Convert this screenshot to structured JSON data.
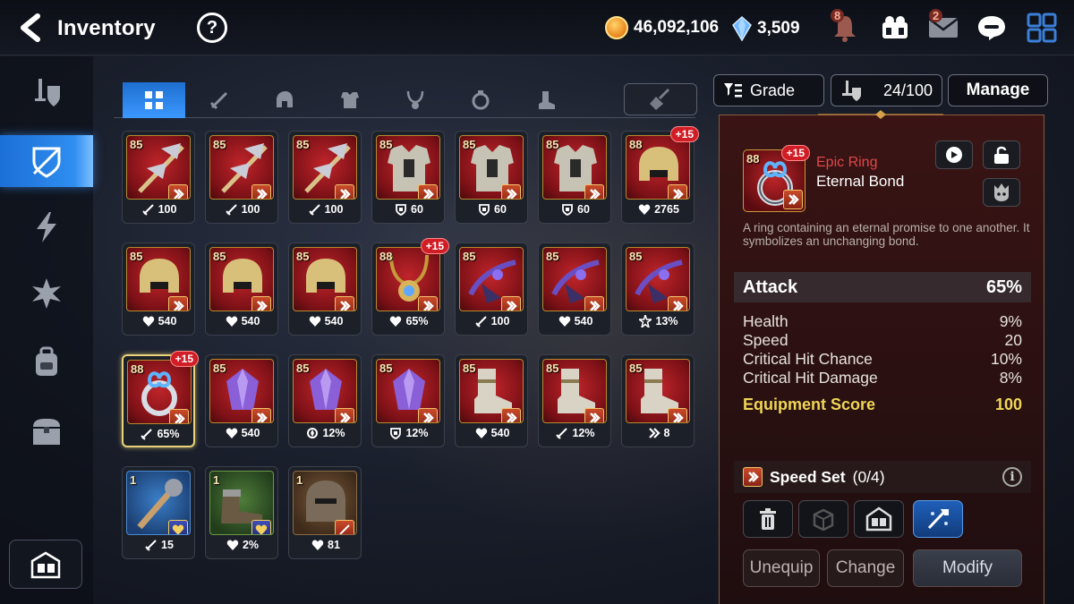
{
  "header": {
    "title": "Inventory",
    "help_label": "?",
    "gold": "46,092,106",
    "crystals": "3,509",
    "notifications_count": "8",
    "mail_count": "2"
  },
  "sidebar": {
    "items": [
      {
        "name": "equipment-tab"
      },
      {
        "name": "gear-tab",
        "active": true
      },
      {
        "name": "artifact-tab"
      },
      {
        "name": "catalyst-tab"
      },
      {
        "name": "materials-tab"
      },
      {
        "name": "chest-tab"
      }
    ]
  },
  "tabs": [
    "all",
    "weapon",
    "helmet",
    "armor",
    "necklace",
    "ring",
    "boots"
  ],
  "controls": {
    "sort_label": "Grade",
    "capacity": "24/100",
    "manage_label": "Manage"
  },
  "items": [
    {
      "level": "85",
      "stat": "100",
      "stat_icon": "attack"
    },
    {
      "level": "85",
      "stat": "100",
      "stat_icon": "attack"
    },
    {
      "level": "85",
      "stat": "100",
      "stat_icon": "attack"
    },
    {
      "level": "85",
      "stat": "60",
      "stat_icon": "defense"
    },
    {
      "level": "85",
      "stat": "60",
      "stat_icon": "defense"
    },
    {
      "level": "85",
      "stat": "60",
      "stat_icon": "defense"
    },
    {
      "level": "88",
      "stat": "2765",
      "stat_icon": "health",
      "enhance": "+15"
    },
    {
      "level": "85",
      "stat": "540",
      "stat_icon": "health"
    },
    {
      "level": "85",
      "stat": "540",
      "stat_icon": "health"
    },
    {
      "level": "85",
      "stat": "540",
      "stat_icon": "health"
    },
    {
      "level": "88",
      "stat": "65%",
      "stat_icon": "health",
      "enhance": "+15"
    },
    {
      "level": "85",
      "stat": "100",
      "stat_icon": "attack"
    },
    {
      "level": "85",
      "stat": "540",
      "stat_icon": "health"
    },
    {
      "level": "85",
      "stat": "13%",
      "stat_icon": "crit"
    },
    {
      "level": "88",
      "stat": "65%",
      "stat_icon": "attack",
      "enhance": "+15",
      "selected": true
    },
    {
      "level": "85",
      "stat": "540",
      "stat_icon": "health"
    },
    {
      "level": "85",
      "stat": "12%",
      "stat_icon": "effect"
    },
    {
      "level": "85",
      "stat": "12%",
      "stat_icon": "defense"
    },
    {
      "level": "85",
      "stat": "540",
      "stat_icon": "health"
    },
    {
      "level": "85",
      "stat": "12%",
      "stat_icon": "attack"
    },
    {
      "level": "85",
      "stat": "8",
      "stat_icon": "speed"
    },
    {
      "level": "1",
      "stat": "15",
      "stat_icon": "attack"
    },
    {
      "level": "1",
      "stat": "2%",
      "stat_icon": "health"
    },
    {
      "level": "1",
      "stat": "81",
      "stat_icon": "health"
    }
  ],
  "detail": {
    "level": "88",
    "enhance": "+15",
    "rarity": "Epic Ring",
    "name": "Eternal Bond",
    "description": "A ring containing an eternal promise to one another. It symbolizes an unchanging bond.",
    "main_stat": {
      "label": "Attack",
      "value": "65%"
    },
    "sub_stats": [
      {
        "label": "Health",
        "value": "9%"
      },
      {
        "label": "Speed",
        "value": "20"
      },
      {
        "label": "Critical Hit Chance",
        "value": "10%"
      },
      {
        "label": "Critical Hit Damage",
        "value": "8%"
      }
    ],
    "score": {
      "label": "Equipment Score",
      "value": "100"
    },
    "set": {
      "label": "Speed Set",
      "progress": "(0/4)"
    },
    "buttons": {
      "unequip": "Unequip",
      "change": "Change",
      "modify": "Modify"
    }
  },
  "colors": {
    "accent_blue": "#2f8ef0",
    "rarity_epic": "#e0474a",
    "score_gold": "#f0d655",
    "enhance_red": "#d11d26"
  }
}
